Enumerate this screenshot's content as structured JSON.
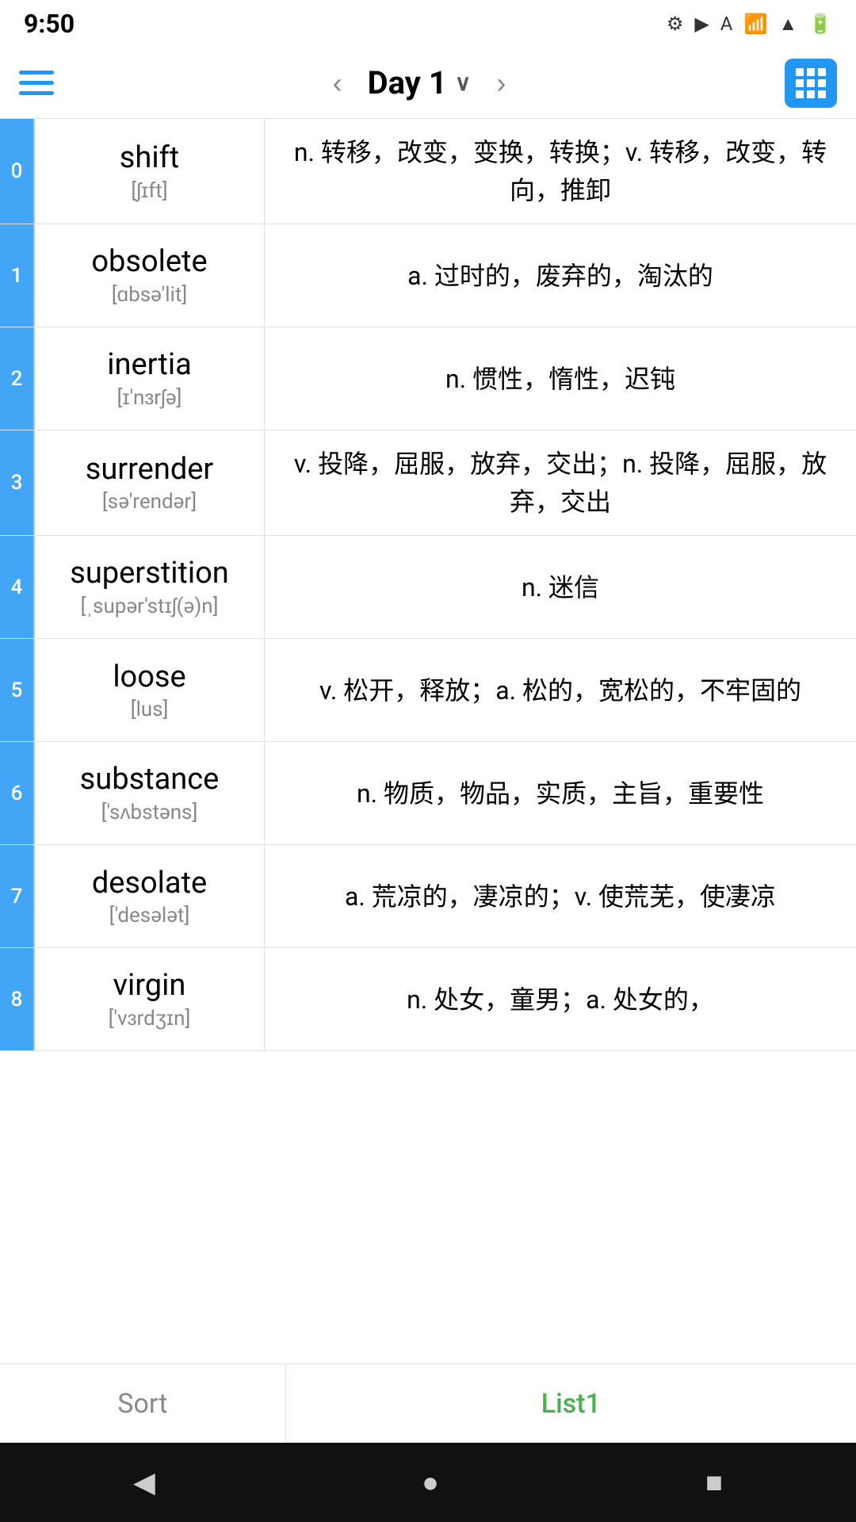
{
  "statusBar": {
    "time": "9:50",
    "icons": [
      "⚙",
      "▶",
      "A",
      "?",
      "•",
      "▲",
      "🔋"
    ]
  },
  "navBar": {
    "prevLabel": "‹",
    "title": "Day 1",
    "titleChevron": "∨",
    "nextLabel": "›"
  },
  "words": [
    {
      "index": "0",
      "word": "shift",
      "phonetic": "[ʃɪft]",
      "definition": "n. 转移，改变，变换，转换；v. 转移，改变，转向，推卸"
    },
    {
      "index": "1",
      "word": "obsolete",
      "phonetic": "[ɑbsə'lit]",
      "definition": "a. 过时的，废弃的，淘汰的"
    },
    {
      "index": "2",
      "word": "inertia",
      "phonetic": "[ɪ'nɜrʃə]",
      "definition": "n. 惯性，惰性，迟钝"
    },
    {
      "index": "3",
      "word": "surrender",
      "phonetic": "[sə'rendər]",
      "definition": "v. 投降，屈服，放弃，交出；n. 投降，屈服，放弃，交出"
    },
    {
      "index": "4",
      "word": "superstition",
      "phonetic": "[ˌsupər'stɪʃ(ə)n]",
      "definition": "n. 迷信"
    },
    {
      "index": "5",
      "word": "loose",
      "phonetic": "[lus]",
      "definition": "v. 松开，释放；a. 松的，宽松的，不牢固的"
    },
    {
      "index": "6",
      "word": "substance",
      "phonetic": "['sʌbstəns]",
      "definition": "n. 物质，物品，实质，主旨，重要性"
    },
    {
      "index": "7",
      "word": "desolate",
      "phonetic": "['desələt]",
      "definition": "a. 荒凉的，凄凉的；v. 使荒芜，使凄凉"
    },
    {
      "index": "8",
      "word": "virgin",
      "phonetic": "['vɜrdʒɪn]",
      "definition": "n. 处女，童男；a. 处女的，"
    }
  ],
  "bottomTabs": {
    "sort": "Sort",
    "list1": "List1"
  },
  "sysNav": {
    "back": "◀",
    "home": "●",
    "recent": "■"
  }
}
